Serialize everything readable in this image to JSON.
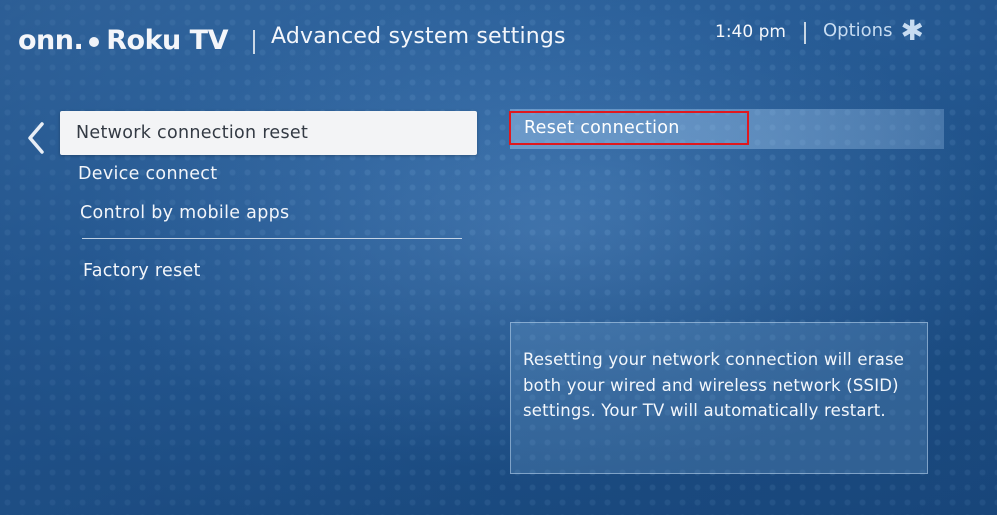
{
  "header": {
    "brand_onn": "onn.",
    "brand_roku": "Roku TV",
    "title": "Advanced system settings",
    "clock": "1:40 pm",
    "options_label": "Options",
    "options_icon": "asterisk-icon"
  },
  "nav": {
    "back_icon": "chevron-left-icon"
  },
  "menu": {
    "selected": "Network connection reset",
    "items": [
      "Device connect",
      "Control by mobile apps",
      "Factory reset"
    ]
  },
  "detail": {
    "action_label": "Reset connection",
    "highlight_color": "#e0181e",
    "info_text": "Resetting your network connection will erase both your wired and wireless network (SSID) settings. Your TV will automatically restart."
  },
  "colors": {
    "background": "#2d65a1",
    "selected_bg": "#f3f4f6",
    "selected_text": "#333a44"
  }
}
